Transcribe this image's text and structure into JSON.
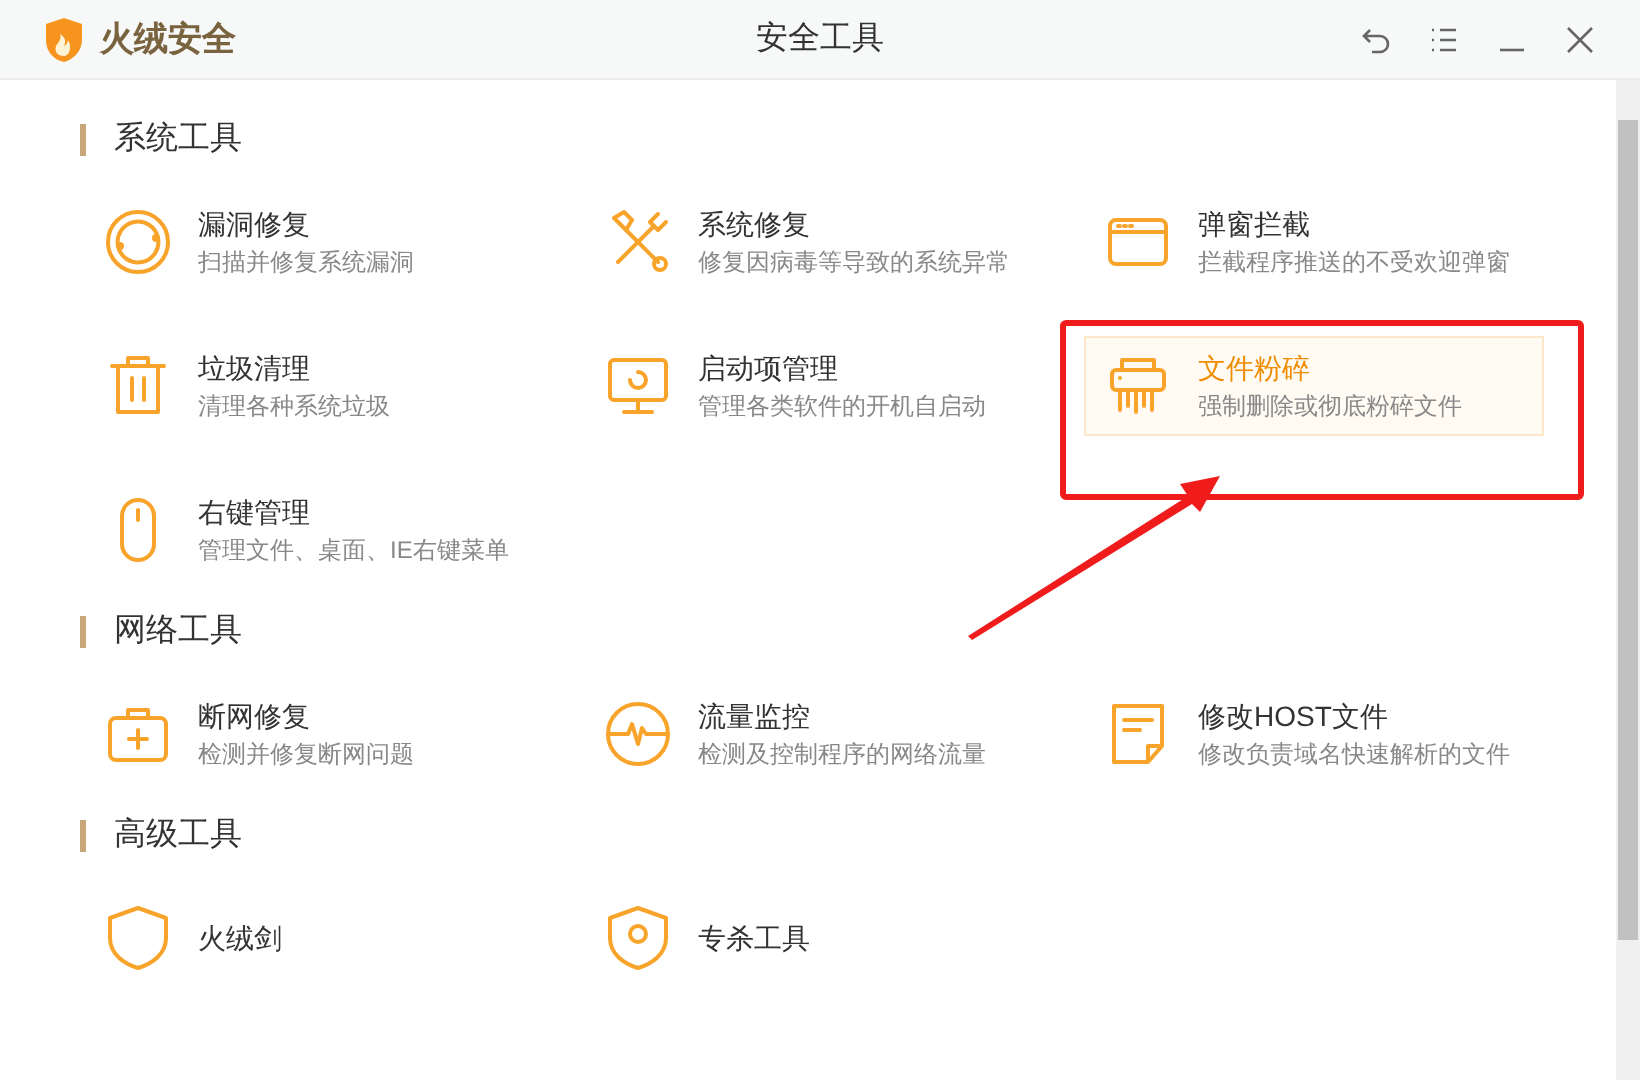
{
  "app": {
    "name": "火绒安全"
  },
  "window": {
    "title": "安全工具"
  },
  "sections": [
    {
      "title": "系统工具",
      "items": [
        {
          "title": "漏洞修复",
          "description": "扫描并修复系统漏洞",
          "selected": false
        },
        {
          "title": "系统修复",
          "description": "修复因病毒等导致的系统异常",
          "selected": false
        },
        {
          "title": "弹窗拦截",
          "description": "拦截程序推送的不受欢迎弹窗",
          "selected": false
        },
        {
          "title": "垃圾清理",
          "description": "清理各种系统垃圾",
          "selected": false
        },
        {
          "title": "启动项管理",
          "description": "管理各类软件的开机自启动",
          "selected": false
        },
        {
          "title": "文件粉碎",
          "description": "强制删除或彻底粉碎文件",
          "selected": true
        },
        {
          "title": "右键管理",
          "description": "管理文件、桌面、IE右键菜单",
          "selected": false
        }
      ]
    },
    {
      "title": "网络工具",
      "items": [
        {
          "title": "断网修复",
          "description": "检测并修复断网问题",
          "selected": false
        },
        {
          "title": "流量监控",
          "description": "检测及控制程序的网络流量",
          "selected": false
        },
        {
          "title": "修改HOST文件",
          "description": "修改负责域名快速解析的文件",
          "selected": false
        }
      ]
    },
    {
      "title": "高级工具",
      "items": [
        {
          "title": "火绒剑",
          "selected": false
        },
        {
          "title": "专杀工具",
          "selected": false
        }
      ]
    }
  ]
}
